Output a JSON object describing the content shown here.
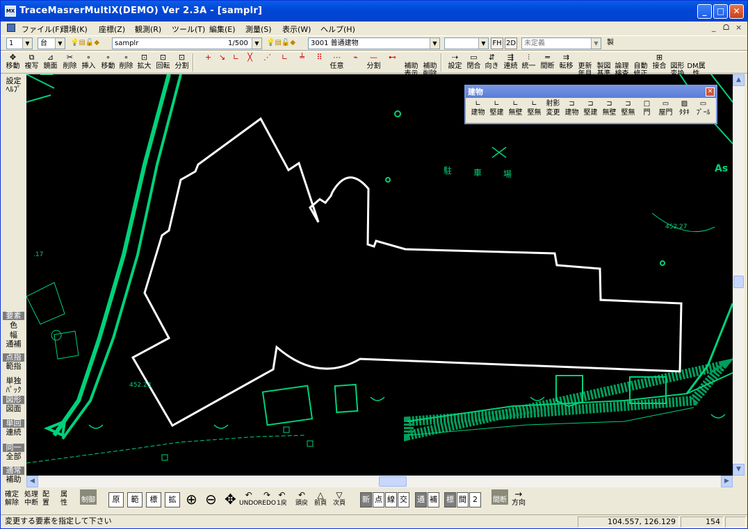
{
  "window": {
    "title": "TraceMasrerMultiX(DEMO) Ver 2.3A - [samplr]",
    "minimize": "_",
    "maximize": "□",
    "close": "✕"
  },
  "menu": [
    "ファイル(F)",
    "環境(K)",
    "座標(Z)",
    "観測(R)",
    "ツール(T)",
    "編集(E)",
    "測量(S)",
    "表示(W)",
    "ヘルプ(H)"
  ],
  "mdi_controls": [
    "_",
    "ᗝ",
    "×"
  ],
  "toolbar1": {
    "layer_no": "1",
    "unit": "台",
    "file": "samplr",
    "scale": "1/500",
    "code": "3001 普通建物",
    "blank": "",
    "fh": "FH",
    "mode2d": "2D",
    "attr": "未定義",
    "make": "製"
  },
  "toolbar2": [
    {
      "label": "移動",
      "icon": "✥"
    },
    {
      "label": "複写",
      "icon": "⧉"
    },
    {
      "label": "鏡面",
      "icon": "⊿"
    },
    {
      "label": "削除",
      "icon": "✂"
    },
    {
      "label": "挿入",
      "icon": "∘"
    },
    {
      "label": "移動",
      "icon": "∘"
    },
    {
      "label": "削除",
      "icon": "∘"
    },
    {
      "label": "拡大",
      "icon": "⊡"
    },
    {
      "label": "回転",
      "icon": "⊡"
    },
    {
      "label": "分割",
      "icon": "⊡"
    },
    {
      "label": "",
      "icon": "+"
    },
    {
      "label": "",
      "icon": "↘"
    },
    {
      "label": "",
      "icon": "∟"
    },
    {
      "label": "",
      "icon": "╳"
    },
    {
      "label": "",
      "icon": "⋰"
    },
    {
      "label": "",
      "icon": "∟"
    },
    {
      "label": "",
      "icon": "╧"
    },
    {
      "label": "",
      "icon": "⠿"
    },
    {
      "label": "任意",
      "icon": "⋯"
    },
    {
      "label": "",
      "icon": "⌁"
    },
    {
      "label": "分割",
      "icon": "—"
    },
    {
      "label": "",
      "icon": "⊷"
    },
    {
      "label": "補助表示",
      "icon": ""
    },
    {
      "label": "補助削除",
      "icon": ""
    },
    {
      "label": "設定",
      "icon": "⇢"
    },
    {
      "label": "閉合",
      "icon": "▭"
    },
    {
      "label": "向き",
      "icon": "⇵"
    },
    {
      "label": "連続",
      "icon": "⇶"
    },
    {
      "label": "統一",
      "icon": "⫶"
    },
    {
      "label": "間断",
      "icon": "═"
    },
    {
      "label": "転移",
      "icon": "⇉"
    },
    {
      "label": "更新年月",
      "icon": ""
    },
    {
      "label": "製図基準",
      "icon": ""
    },
    {
      "label": "論理検査",
      "icon": ""
    },
    {
      "label": "自動修正",
      "icon": ""
    },
    {
      "label": "接合",
      "icon": "⊞"
    },
    {
      "label": "図形変換",
      "icon": ""
    },
    {
      "label": "DM属性",
      "icon": ""
    }
  ],
  "left_toolbar": [
    {
      "text": "設定\nﾍﾙﾌﾟ",
      "on": false
    },
    {
      "text": "要素",
      "on": true
    },
    {
      "text": "色",
      "on": false
    },
    {
      "text": "幅",
      "on": false
    },
    {
      "text": "通補",
      "on": false
    },
    {
      "text": "点指",
      "on": true
    },
    {
      "text": "範指",
      "on": false
    },
    {
      "text": "単独",
      "on": false
    },
    {
      "text": "ﾊﾟｯｸ",
      "on": false
    },
    {
      "text": "図形",
      "on": true
    },
    {
      "text": "図面",
      "on": false
    },
    {
      "text": "単回",
      "on": true
    },
    {
      "text": "連続",
      "on": false
    },
    {
      "text": "同一",
      "on": true
    },
    {
      "text": "全部",
      "on": false
    },
    {
      "text": "通常",
      "on": true
    },
    {
      "text": "補助",
      "on": false
    }
  ],
  "float_panel": {
    "title": "建物",
    "close": "✕",
    "buttons": [
      {
        "label": "建物",
        "icon": "∟"
      },
      {
        "label": "堅建",
        "icon": "∟"
      },
      {
        "label": "無壁",
        "icon": "∟"
      },
      {
        "label": "堅無",
        "icon": "∟"
      },
      {
        "label": "変更",
        "icon": "射影"
      },
      {
        "label": "建物",
        "icon": "⊐"
      },
      {
        "label": "堅建",
        "icon": "⊐"
      },
      {
        "label": "無壁",
        "icon": "⊐"
      },
      {
        "label": "堅無",
        "icon": "⊐"
      },
      {
        "label": "門",
        "icon": "□"
      },
      {
        "label": "屋門",
        "icon": "▭"
      },
      {
        "label": "ﾀﾀｷ",
        "icon": "▨"
      },
      {
        "label": "ﾌﾟｰﾙ",
        "icon": "▭"
      }
    ]
  },
  "map": {
    "labels": [
      "駐",
      "車",
      "場",
      "As",
      "452.27",
      "452.23",
      ".17"
    ]
  },
  "bottom_toolbar": {
    "left": [
      {
        "label": "確定\n解除"
      },
      {
        "label": "処理\n中断"
      },
      {
        "label": "配\n置"
      },
      {
        "label": "属\n性"
      },
      {
        "label": "制御"
      }
    ],
    "boxes": [
      "原",
      "範",
      "標",
      "拡"
    ],
    "undo": [
      {
        "label": "UNDO",
        "icon": "↶"
      },
      {
        "label": "REDO",
        "icon": "↷"
      },
      {
        "label": "1戻",
        "icon": "↶"
      },
      {
        "label": "頭戻",
        "icon": "↶"
      },
      {
        "label": "前頁",
        "icon": "△"
      },
      {
        "label": "次頁",
        "icon": "▽"
      }
    ],
    "snaps": [
      "新",
      "点",
      "線",
      "交"
    ],
    "snaps2": [
      "通",
      "補"
    ],
    "snaps3": [
      "標",
      "間",
      "2"
    ],
    "right": [
      {
        "label": "間断"
      },
      {
        "label": "方向",
        "icon": "→"
      }
    ]
  },
  "status": {
    "message": "変更する要素を指定して下さい",
    "coords": "104.557,    126.129",
    "count": "154"
  },
  "colors": {
    "map_line": "#00d27a",
    "building": "#ffffff",
    "background": "#000000"
  }
}
